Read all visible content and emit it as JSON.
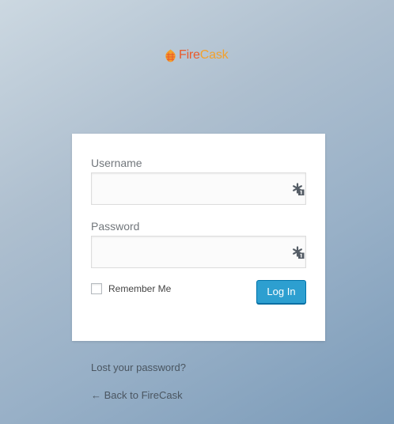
{
  "brand": {
    "name_part1": "Fire",
    "name_part2": "Cask",
    "logo_icon": "firecask-logo-icon"
  },
  "login_form": {
    "username_label": "Username",
    "username_value": "",
    "password_label": "Password",
    "password_value": "",
    "password_manager_icon": "password-manager-icon",
    "remember_label": "Remember Me",
    "remember_checked": false,
    "submit_label": "Log In"
  },
  "links": {
    "lost_password": "Lost your password?",
    "back_to_site": "← Back to FireCask"
  },
  "colors": {
    "accent_button": "#2d9fd0",
    "brand_fire": "#ea5a2b",
    "brand_cask": "#f3a12c"
  }
}
